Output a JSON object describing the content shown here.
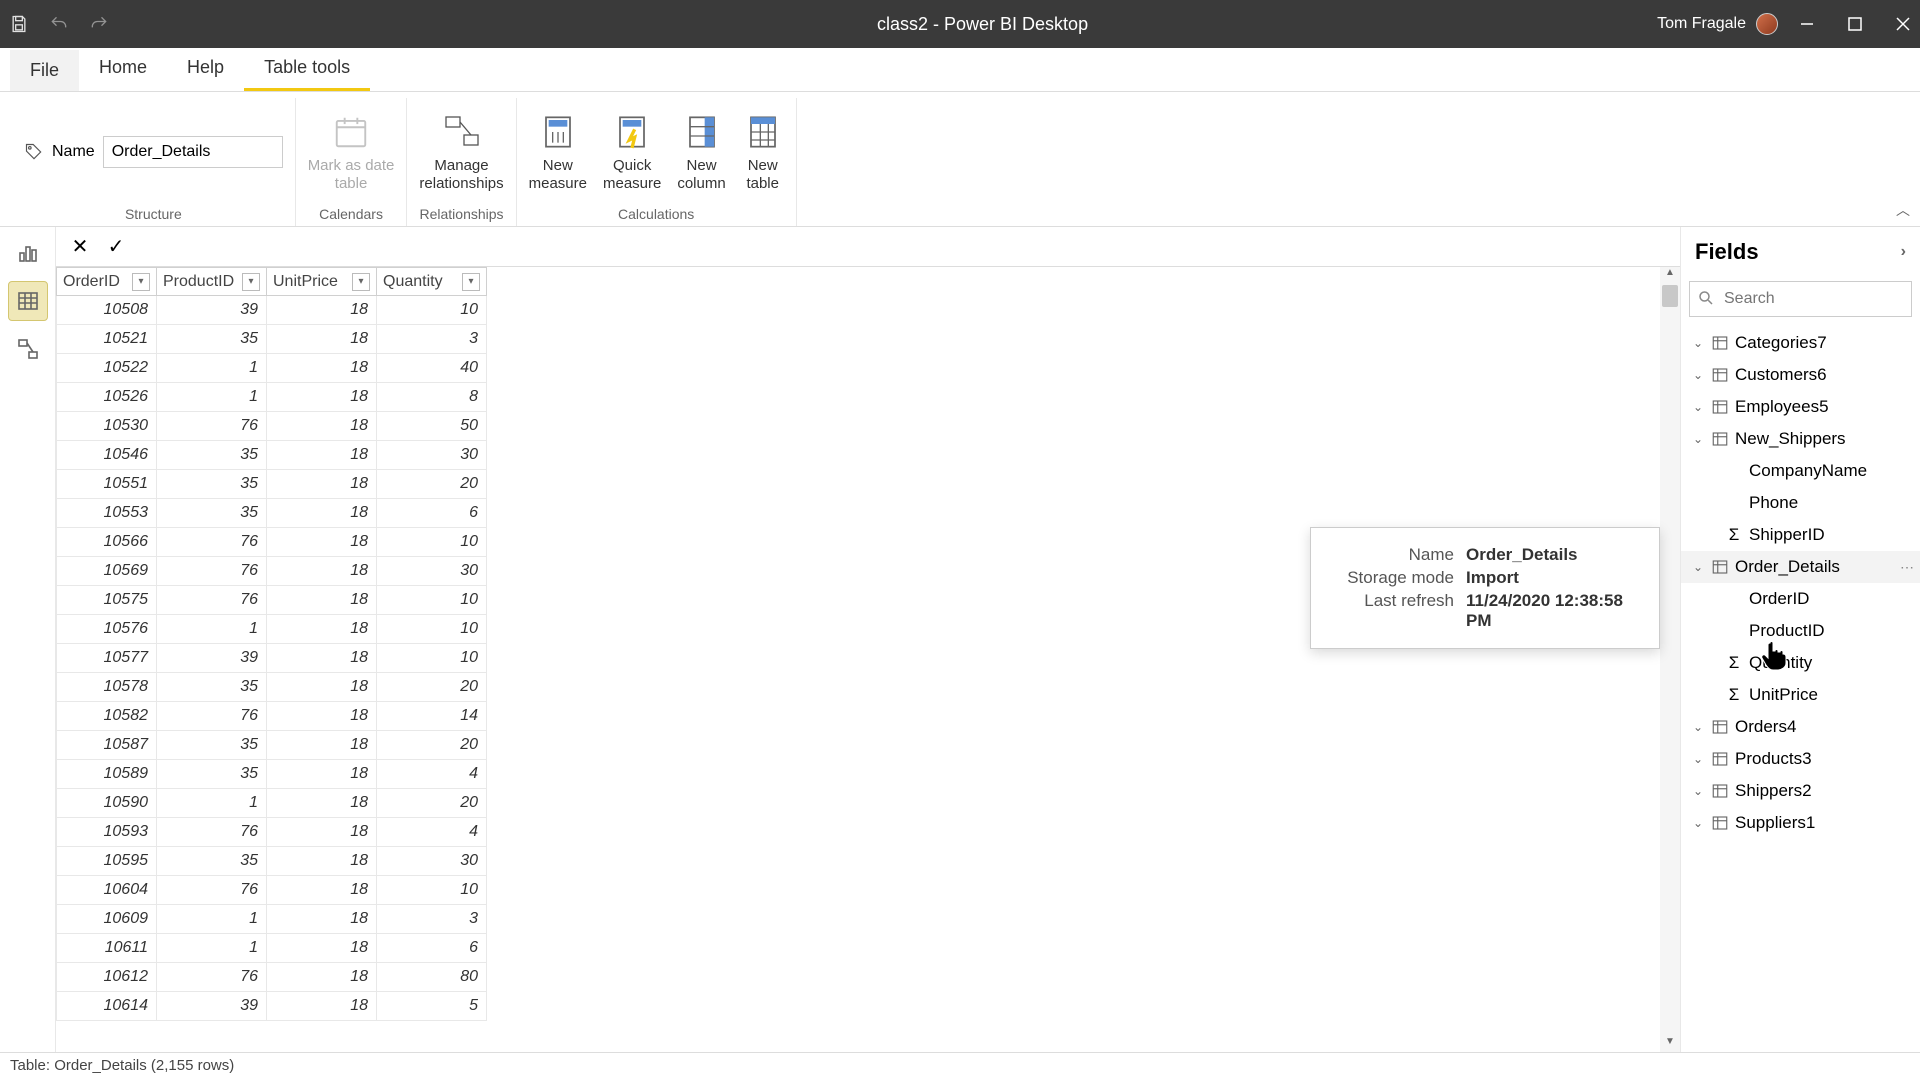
{
  "titlebar": {
    "title": "class2 - Power BI Desktop",
    "user": "Tom Fragale"
  },
  "tabs": {
    "file": "File",
    "items": [
      "Home",
      "Help",
      "Table tools"
    ],
    "active": 2
  },
  "ribbon": {
    "name_label": "Name",
    "name_value": "Order_Details",
    "groups": {
      "structure": "Structure",
      "calendars": "Calendars",
      "relationships": "Relationships",
      "calculations": "Calculations"
    },
    "buttons": {
      "mark_as_date": "Mark as date\ntable",
      "manage_rel": "Manage\nrelationships",
      "new_measure": "New\nmeasure",
      "quick_measure": "Quick\nmeasure",
      "new_column": "New\ncolumn",
      "new_table": "New\ntable"
    }
  },
  "grid": {
    "columns": [
      "OrderID",
      "ProductID",
      "UnitPrice",
      "Quantity"
    ],
    "rows": [
      [
        10508,
        39,
        18,
        10
      ],
      [
        10521,
        35,
        18,
        3
      ],
      [
        10522,
        1,
        18,
        40
      ],
      [
        10526,
        1,
        18,
        8
      ],
      [
        10530,
        76,
        18,
        50
      ],
      [
        10546,
        35,
        18,
        30
      ],
      [
        10551,
        35,
        18,
        20
      ],
      [
        10553,
        35,
        18,
        6
      ],
      [
        10566,
        76,
        18,
        10
      ],
      [
        10569,
        76,
        18,
        30
      ],
      [
        10575,
        76,
        18,
        10
      ],
      [
        10576,
        1,
        18,
        10
      ],
      [
        10577,
        39,
        18,
        10
      ],
      [
        10578,
        35,
        18,
        20
      ],
      [
        10582,
        76,
        18,
        14
      ],
      [
        10587,
        35,
        18,
        20
      ],
      [
        10589,
        35,
        18,
        4
      ],
      [
        10590,
        1,
        18,
        20
      ],
      [
        10593,
        76,
        18,
        4
      ],
      [
        10595,
        35,
        18,
        30
      ],
      [
        10604,
        76,
        18,
        10
      ],
      [
        10609,
        1,
        18,
        3
      ],
      [
        10611,
        1,
        18,
        6
      ],
      [
        10612,
        76,
        18,
        80
      ],
      [
        10614,
        39,
        18,
        5
      ]
    ]
  },
  "tooltip": {
    "rows": [
      {
        "k": "Name",
        "v": "Order_Details"
      },
      {
        "k": "Storage mode",
        "v": "Import"
      },
      {
        "k": "Last refresh",
        "v": "11/24/2020 12:38:58 PM"
      }
    ]
  },
  "fields": {
    "title": "Fields",
    "search_placeholder": "Search",
    "tables": [
      {
        "name": "Categories7",
        "expanded": false
      },
      {
        "name": "Customers6",
        "expanded": false
      },
      {
        "name": "Employees5",
        "expanded": false
      },
      {
        "name": "New_Shippers",
        "expanded": true,
        "fields": [
          {
            "name": "CompanyName"
          },
          {
            "name": "Phone"
          },
          {
            "name": "ShipperID",
            "sigma": true
          }
        ]
      },
      {
        "name": "Order_Details",
        "expanded": true,
        "hover": true,
        "fields": [
          {
            "name": "OrderID"
          },
          {
            "name": "ProductID"
          },
          {
            "name": "Quantity",
            "sigma": true
          },
          {
            "name": "UnitPrice",
            "sigma": true
          }
        ]
      },
      {
        "name": "Orders4",
        "expanded": false
      },
      {
        "name": "Products3",
        "expanded": false
      },
      {
        "name": "Shippers2",
        "expanded": false
      },
      {
        "name": "Suppliers1",
        "expanded": false
      }
    ]
  },
  "status": "Table: Order_Details (2,155 rows)"
}
